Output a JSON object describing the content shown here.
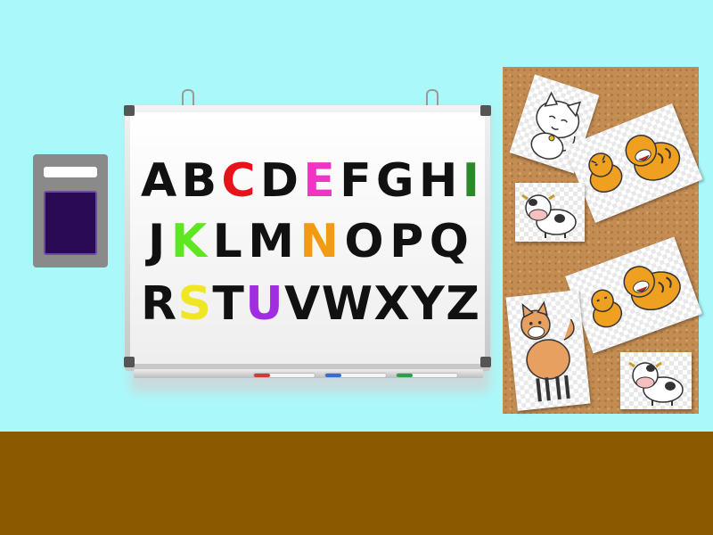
{
  "scene": {
    "wall_color": "#aaf8fa",
    "floor_color": "#8b5a00"
  },
  "whiteboard": {
    "rows": [
      [
        {
          "char": "A",
          "color": "#111111"
        },
        {
          "char": "B",
          "color": "#111111"
        },
        {
          "char": "C",
          "color": "#e8121b"
        },
        {
          "char": "D",
          "color": "#111111"
        },
        {
          "char": "E",
          "color": "#f035c4"
        },
        {
          "char": "F",
          "color": "#111111"
        },
        {
          "char": "G",
          "color": "#111111"
        },
        {
          "char": "H",
          "color": "#111111"
        },
        {
          "char": "I",
          "color": "#2a8a2a"
        }
      ],
      [
        {
          "char": "J",
          "color": "#111111"
        },
        {
          "char": "K",
          "color": "#5ee620"
        },
        {
          "char": "L",
          "color": "#111111"
        },
        {
          "char": "M",
          "color": "#111111"
        },
        {
          "char": "N",
          "color": "#f29a12"
        },
        {
          "char": "O",
          "color": "#111111"
        },
        {
          "char": "P",
          "color": "#111111"
        },
        {
          "char": "Q",
          "color": "#111111"
        }
      ],
      [
        {
          "char": "R",
          "color": "#111111"
        },
        {
          "char": "S",
          "color": "#f0e628"
        },
        {
          "char": "T",
          "color": "#111111"
        },
        {
          "char": "U",
          "color": "#a02ee0"
        },
        {
          "char": "V",
          "color": "#111111"
        },
        {
          "char": "W",
          "color": "#111111"
        },
        {
          "char": "X",
          "color": "#111111"
        },
        {
          "char": "Y",
          "color": "#111111"
        },
        {
          "char": "Z",
          "color": "#111111"
        }
      ]
    ],
    "markers": [
      {
        "name": "red-marker",
        "color": "#d23a3a"
      },
      {
        "name": "blue-marker",
        "color": "#3a6ad2"
      },
      {
        "name": "green-marker",
        "color": "#2aa04a"
      }
    ]
  },
  "light_switch": {
    "icon": "light-switch-icon"
  },
  "cork_board": {
    "cards": [
      {
        "name": "cat-card",
        "icon": "cat-icon"
      },
      {
        "name": "tigers-card-1",
        "icon": "tiger-icon"
      },
      {
        "name": "cow-card-1",
        "icon": "cow-icon"
      },
      {
        "name": "tigers-card-2",
        "icon": "tiger-icon"
      },
      {
        "name": "shiba-dog-card",
        "icon": "dog-icon"
      },
      {
        "name": "cow-card-2",
        "icon": "cow-icon"
      }
    ]
  }
}
